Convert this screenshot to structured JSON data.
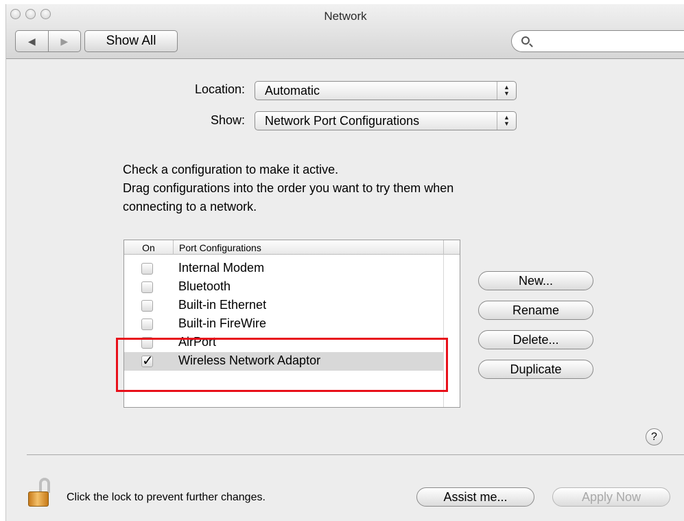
{
  "window": {
    "title": "Network",
    "nav_back": "◀",
    "nav_forward": "▶",
    "show_all_label": "Show All",
    "search_placeholder": ""
  },
  "location": {
    "label": "Location:",
    "value": "Automatic"
  },
  "show": {
    "label": "Show:",
    "value": "Network Port Configurations"
  },
  "instructions": [
    "Check a configuration to make it active.",
    "Drag configurations into the order you want to try them when",
    "connecting to a network."
  ],
  "table": {
    "headers": {
      "on": "On",
      "name": "Port Configurations"
    },
    "rows": [
      {
        "name": "Internal Modem",
        "checked": false
      },
      {
        "name": "Bluetooth",
        "checked": false
      },
      {
        "name": "Built-in Ethernet",
        "checked": false
      },
      {
        "name": "Built-in FireWire",
        "checked": false
      },
      {
        "name": "AirPort",
        "checked": false
      },
      {
        "name": "Wireless Network Adaptor",
        "checked": true
      }
    ],
    "check_mark": "✓"
  },
  "buttons": {
    "new": "New...",
    "rename": "Rename",
    "delete": "Delete...",
    "duplicate": "Duplicate",
    "help": "?",
    "assist": "Assist me...",
    "apply": "Apply Now"
  },
  "footer": {
    "lock_text": "Click the lock to prevent further changes."
  },
  "colors": {
    "highlight_box": "#e8101a",
    "selected_row": "#d8d8d8"
  }
}
